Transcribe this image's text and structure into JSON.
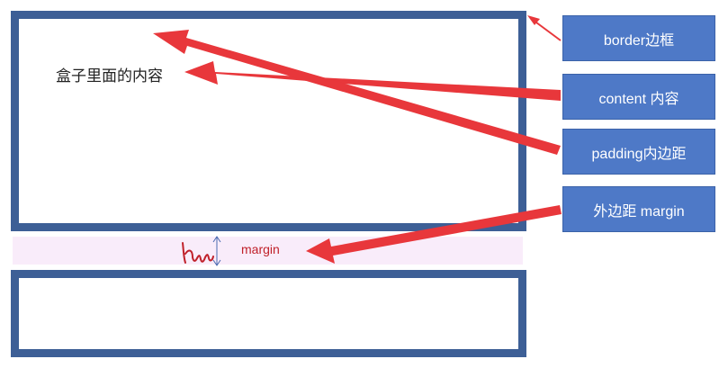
{
  "diagram": {
    "content_text": "盒子里面的内容",
    "margin_label": "margin",
    "callouts": {
      "border": "border边框",
      "content": "content 内容",
      "padding": "padding内边距",
      "margin": "外边距 margin"
    }
  },
  "colors": {
    "box_border": "#3d5f96",
    "callout_fill": "#4e79c7",
    "arrow": "#e8373b",
    "margin_band": "#f9ecfa",
    "margin_text": "#c0202a"
  }
}
